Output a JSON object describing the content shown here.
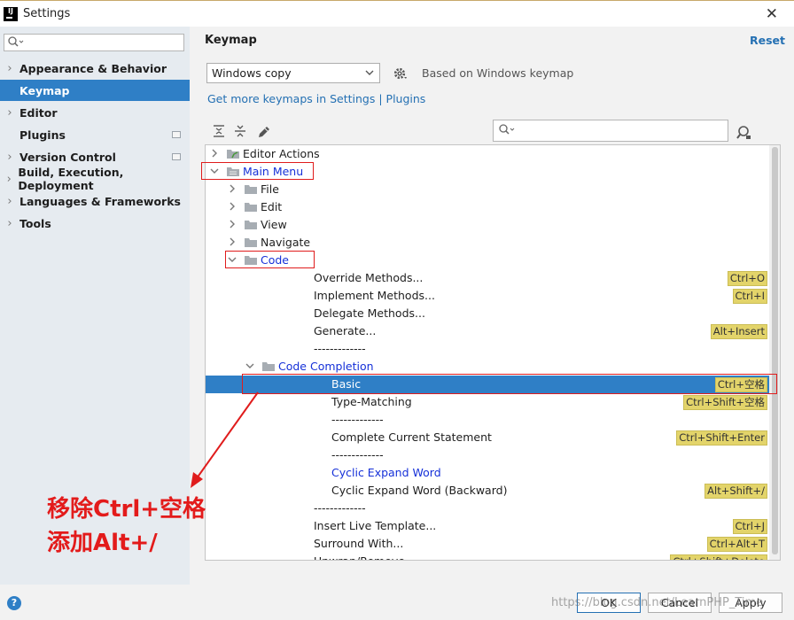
{
  "window": {
    "title": "Settings"
  },
  "sidebar": {
    "search_placeholder": "",
    "items": [
      {
        "label": "Appearance & Behavior",
        "expandable": true
      },
      {
        "label": "Keymap",
        "expandable": false,
        "selected": true
      },
      {
        "label": "Editor",
        "expandable": true
      },
      {
        "label": "Plugins",
        "expandable": false,
        "badge": true
      },
      {
        "label": "Version Control",
        "expandable": true,
        "badge": true
      },
      {
        "label": "Build, Execution, Deployment",
        "expandable": true
      },
      {
        "label": "Languages & Frameworks",
        "expandable": true
      },
      {
        "label": "Tools",
        "expandable": true
      }
    ]
  },
  "main": {
    "title": "Keymap",
    "reset_label": "Reset",
    "keymap_value": "Windows copy",
    "based_on": "Based on Windows keymap",
    "plugins_link": "Get more keymaps in Settings | Plugins",
    "filter_placeholder": ""
  },
  "tree": [
    {
      "label": "Editor Actions",
      "indent": 0,
      "exp": "right",
      "icon": "editor-actions-icon"
    },
    {
      "label": "Main Menu",
      "indent": 0,
      "exp": "down",
      "icon": "menu-folder-icon",
      "blue": true
    },
    {
      "label": "File",
      "indent": 1,
      "exp": "right",
      "icon": "folder-icon"
    },
    {
      "label": "Edit",
      "indent": 1,
      "exp": "right",
      "icon": "folder-icon"
    },
    {
      "label": "View",
      "indent": 1,
      "exp": "right",
      "icon": "folder-icon"
    },
    {
      "label": "Navigate",
      "indent": 1,
      "exp": "right",
      "icon": "folder-icon"
    },
    {
      "label": "Code",
      "indent": 1,
      "exp": "down",
      "icon": "folder-icon",
      "blue": true
    },
    {
      "label": "Override Methods...",
      "indent": 2,
      "shortcut": "Ctrl+O"
    },
    {
      "label": "Implement Methods...",
      "indent": 2,
      "shortcut": "Ctrl+I"
    },
    {
      "label": "Delegate Methods...",
      "indent": 2
    },
    {
      "label": "Generate...",
      "indent": 2,
      "shortcut": "Alt+Insert"
    },
    {
      "label": "-------------",
      "indent": 2
    },
    {
      "label": "Code Completion",
      "indent": 2,
      "exp": "down",
      "icon": "folder-icon",
      "blue": true
    },
    {
      "label": "Basic",
      "indent": 3,
      "shortcut": "Ctrl+空格",
      "selected": true
    },
    {
      "label": "Type-Matching",
      "indent": 3,
      "shortcut": "Ctrl+Shift+空格"
    },
    {
      "label": "-------------",
      "indent": 3
    },
    {
      "label": "Complete Current Statement",
      "indent": 3,
      "shortcut": "Ctrl+Shift+Enter"
    },
    {
      "label": "-------------",
      "indent": 3
    },
    {
      "label": "Cyclic Expand Word",
      "indent": 3,
      "blue": true
    },
    {
      "label": "Cyclic Expand Word (Backward)",
      "indent": 3,
      "shortcut": "Alt+Shift+/"
    },
    {
      "label": "-------------",
      "indent": 2
    },
    {
      "label": "Insert Live Template...",
      "indent": 2,
      "shortcut": "Ctrl+J"
    },
    {
      "label": "Surround With...",
      "indent": 2,
      "shortcut": "Ctrl+Alt+T"
    },
    {
      "label": "Unwrap/Remove...",
      "indent": 2,
      "shortcut": "Ctrl+Shift+Delete"
    }
  ],
  "annotation": {
    "line1": "移除Ctrl+空格",
    "line2": "添加Alt+/"
  },
  "footer": {
    "help": "?",
    "ok": "OK",
    "cancel": "Cancel",
    "apply": "Apply"
  },
  "watermark": "https://blog.csdn.net/LearnPHP_Time",
  "colors": {
    "accent": "#2f7fc6",
    "link": "#2470b3",
    "highlight_blue": "#1530d8",
    "shortcut_bg": "#e3d46a",
    "annotation_red": "#e31b1b"
  }
}
